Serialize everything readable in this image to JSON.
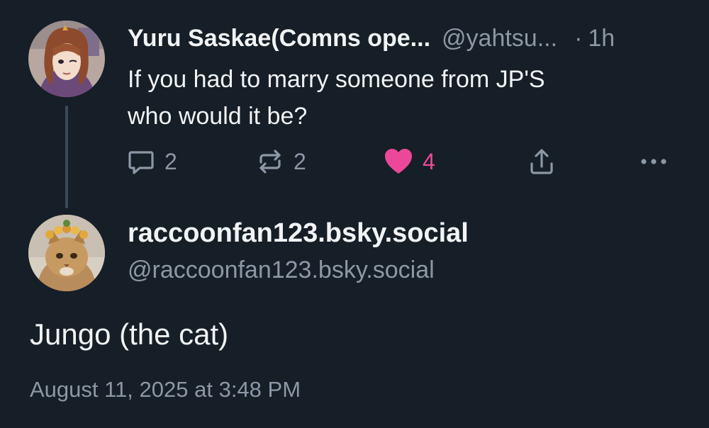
{
  "parent_post": {
    "author_name": "Yuru Saskae(Comns ope...",
    "author_handle": "@yahtsu...",
    "separator": "·",
    "time_ago": "1h",
    "text_lines": [
      "If you had to marry someone from JP'S",
      "who would it be?"
    ],
    "actions": {
      "reply_count": "2",
      "repost_count": "2",
      "like_count": "4",
      "liked": true
    }
  },
  "reply_post": {
    "author_name": "raccoonfan123.bsky.social",
    "author_handle": "@raccoonfan123.bsky.social",
    "text": "Jungo (the cat)",
    "timestamp": "August 11, 2025 at 3:48 PM"
  },
  "colors": {
    "background": "#161e27",
    "text_primary": "#f1f3f5",
    "text_secondary": "#8b98a6",
    "like_accent": "#ec4899",
    "thread_line": "#3a4a5c"
  },
  "icons": {
    "reply": "speech-bubble-icon",
    "repost": "repost-arrows-icon",
    "like": "heart-icon",
    "share": "share-upload-icon",
    "more": "more-dots-icon"
  }
}
